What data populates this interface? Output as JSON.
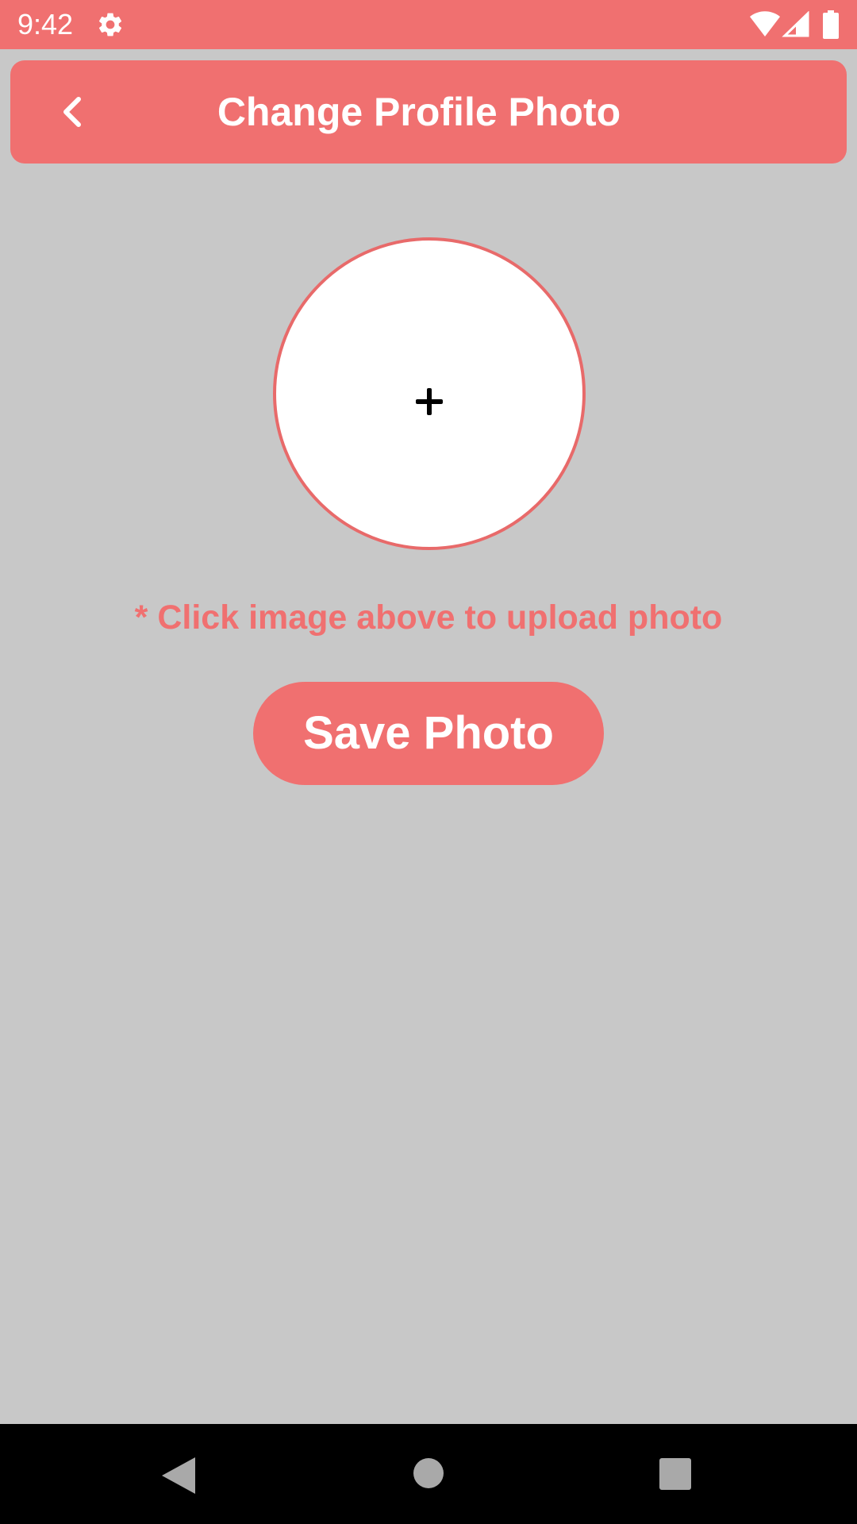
{
  "status_bar": {
    "time": "9:42",
    "icons": [
      "gear-icon",
      "wifi-icon",
      "signal-icon",
      "battery-icon"
    ]
  },
  "app_bar": {
    "title": "Change Profile Photo",
    "back_icon": "chevron-left-icon"
  },
  "photo_picker": {
    "icon": "plus-icon"
  },
  "hint_text": "* Click image above to upload photo",
  "save_button": {
    "label": "Save Photo"
  },
  "nav_bar": {
    "icons": [
      "nav-back-icon",
      "nav-home-icon",
      "nav-recents-icon"
    ]
  },
  "colors": {
    "accent": "#f07070",
    "background": "#c8c8c8",
    "picker_fill": "#ffffff",
    "nav_bar": "#000000"
  }
}
